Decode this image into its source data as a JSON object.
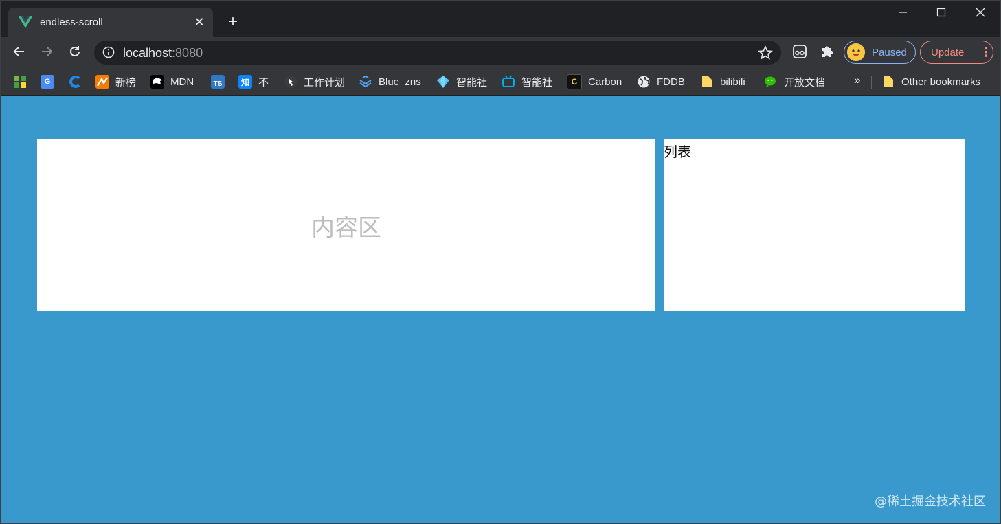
{
  "tab": {
    "title": "endless-scroll",
    "close": "✕"
  },
  "newtab": "+",
  "address": {
    "host": "localhost",
    "port": ":8080"
  },
  "profile": {
    "label": "Paused"
  },
  "update": {
    "label": "Update",
    "menu": "⋮"
  },
  "bookmarks": {
    "items": [
      {
        "label": "",
        "icon": "apps-grid-icon"
      },
      {
        "label": "",
        "icon": "google-translate-icon"
      },
      {
        "label": "",
        "icon": "c-logo-icon"
      },
      {
        "label": "新榜",
        "icon": "xinbang-icon"
      },
      {
        "label": "MDN",
        "icon": "mdn-icon"
      },
      {
        "label": "",
        "icon": "typescript-icon"
      },
      {
        "label": "不",
        "icon": "zhihu-icon"
      },
      {
        "label": "工作计划",
        "icon": "arrow-cursor-icon"
      },
      {
        "label": "Blue_zns",
        "icon": "layers-icon"
      },
      {
        "label": "智能社",
        "icon": "gem-icon"
      },
      {
        "label": "智能社",
        "icon": "bilibili-tv-icon"
      },
      {
        "label": "Carbon",
        "icon": "carbon-icon"
      },
      {
        "label": "FDDB",
        "icon": "globe-icon"
      },
      {
        "label": "bilibili",
        "icon": "folder-icon"
      },
      {
        "label": "开放文档",
        "icon": "wechat-icon"
      }
    ],
    "more": "»",
    "other": "Other bookmarks"
  },
  "page": {
    "content_label": "内容区",
    "list_label": "列表",
    "watermark": "@稀土掘金技术社区"
  },
  "colors": {
    "page_background": "#3999cc",
    "chrome_dark": "#202124",
    "chrome_toolbar": "#35363a",
    "profile_accent": "#8ab4f8",
    "update_accent": "#f28b82"
  }
}
